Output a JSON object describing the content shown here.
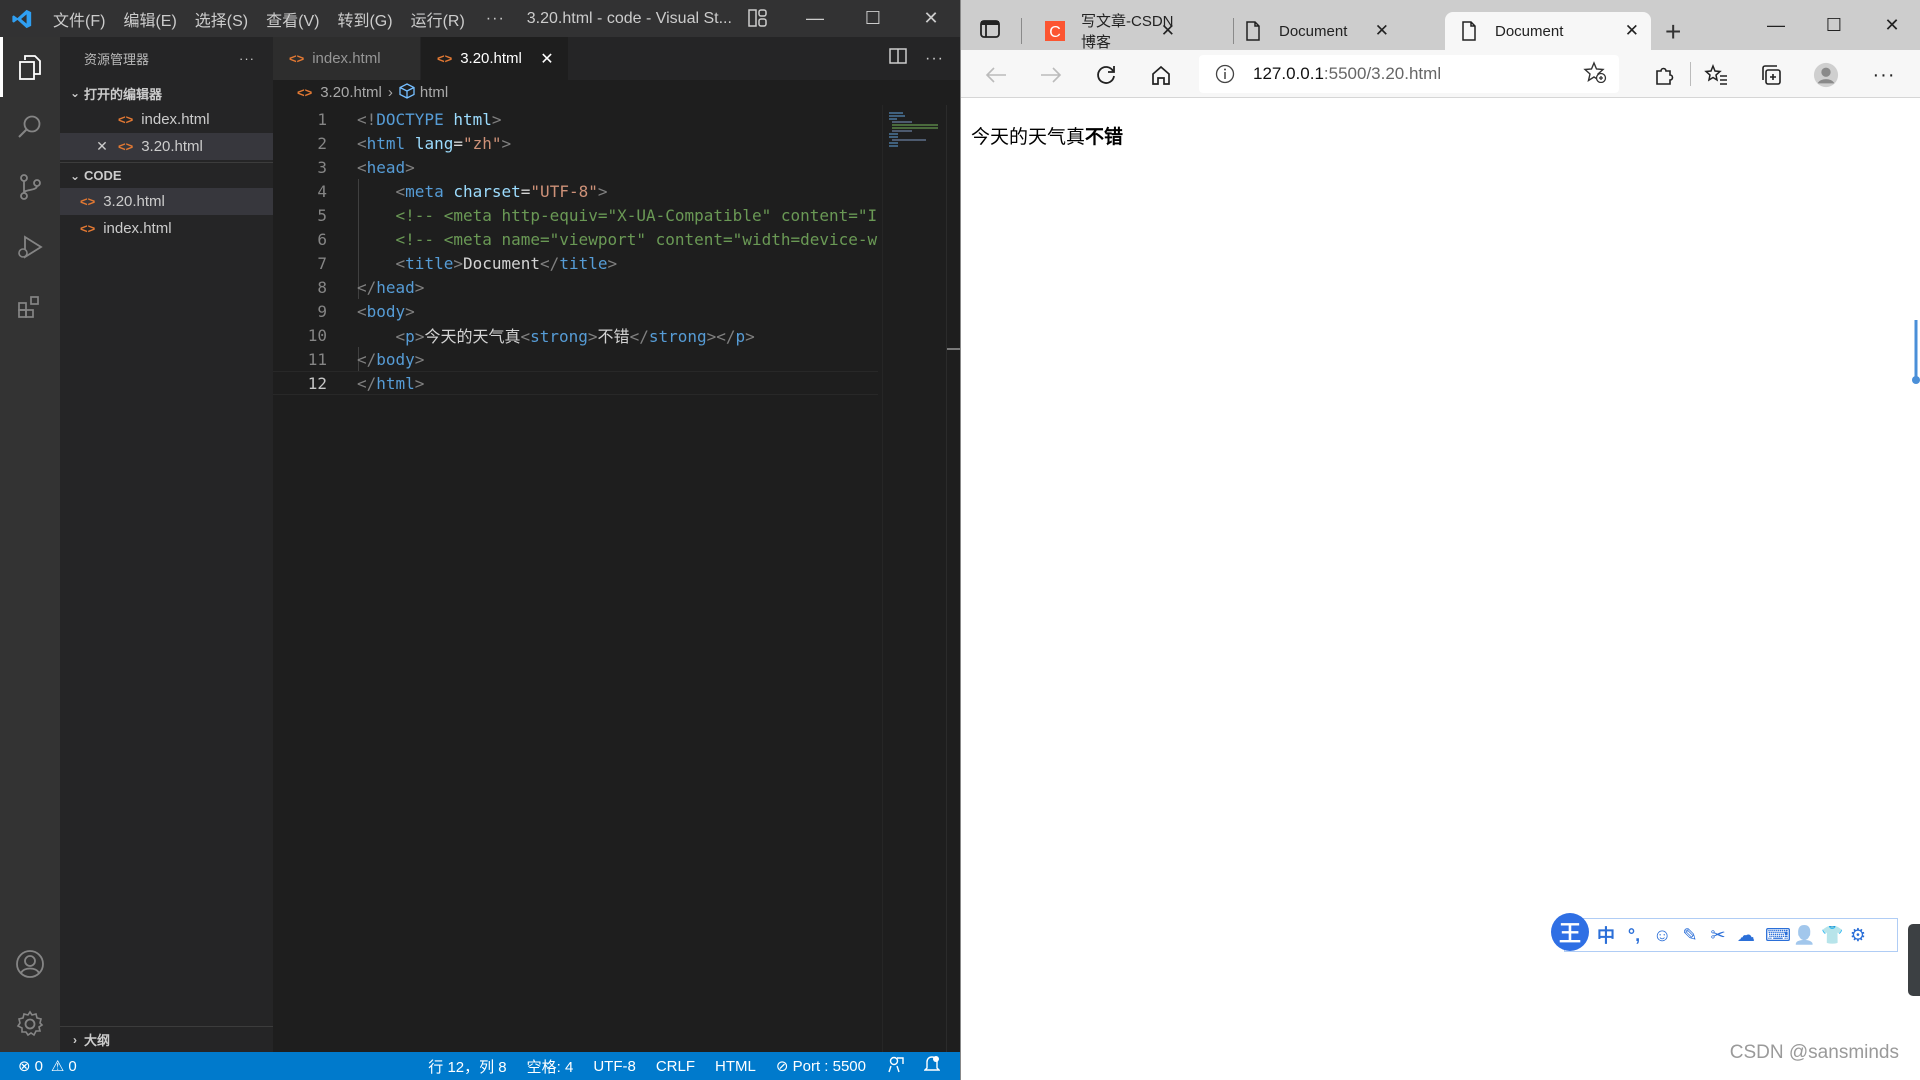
{
  "vscode": {
    "menu": [
      "文件(F)",
      "编辑(E)",
      "选择(S)",
      "查看(V)",
      "转到(G)",
      "运行(R)"
    ],
    "menu_more": "···",
    "window_title": "3.20.html - code - Visual St...",
    "explorer": {
      "header": "资源管理器",
      "header_more": "···",
      "open_editors_label": "打开的编辑器",
      "open_editors": [
        {
          "name": "index.html"
        },
        {
          "name": "3.20.html"
        }
      ],
      "folder_label": "CODE",
      "files": [
        {
          "name": "3.20.html"
        },
        {
          "name": "index.html"
        }
      ],
      "outline_label": "大纲"
    },
    "tabs": [
      {
        "label": "index.html",
        "active": false
      },
      {
        "label": "3.20.html",
        "active": true
      }
    ],
    "breadcrumb": {
      "file": "3.20.html",
      "symbol": "html"
    },
    "code_lines": [
      {
        "n": "1",
        "tokens": [
          [
            "punc",
            "<!"
          ],
          [
            "tag",
            "DOCTYPE"
          ],
          [
            "text",
            " "
          ],
          [
            "attr",
            "html"
          ],
          [
            "punc",
            ">"
          ]
        ]
      },
      {
        "n": "2",
        "tokens": [
          [
            "punc",
            "<"
          ],
          [
            "tag",
            "html"
          ],
          [
            "text",
            " "
          ],
          [
            "attr",
            "lang"
          ],
          [
            "text",
            "="
          ],
          [
            "str",
            "\"zh\""
          ],
          [
            "punc",
            ">"
          ]
        ]
      },
      {
        "n": "3",
        "tokens": [
          [
            "punc",
            "<"
          ],
          [
            "tag",
            "head"
          ],
          [
            "punc",
            ">"
          ]
        ]
      },
      {
        "n": "4",
        "tokens": [
          [
            "text",
            "    "
          ],
          [
            "punc",
            "<"
          ],
          [
            "tag",
            "meta"
          ],
          [
            "text",
            " "
          ],
          [
            "attr",
            "charset"
          ],
          [
            "text",
            "="
          ],
          [
            "str",
            "\"UTF-8\""
          ],
          [
            "punc",
            ">"
          ]
        ]
      },
      {
        "n": "5",
        "tokens": [
          [
            "text",
            "    "
          ],
          [
            "com",
            "<!-- <meta http-equiv=\"X-UA-Compatible\" content=\"I"
          ]
        ]
      },
      {
        "n": "6",
        "tokens": [
          [
            "text",
            "    "
          ],
          [
            "com",
            "<!-- <meta name=\"viewport\" content=\"width=device-w"
          ]
        ]
      },
      {
        "n": "7",
        "tokens": [
          [
            "text",
            "    "
          ],
          [
            "punc",
            "<"
          ],
          [
            "tag",
            "title"
          ],
          [
            "punc",
            ">"
          ],
          [
            "text",
            "Document"
          ],
          [
            "punc",
            "</"
          ],
          [
            "tag",
            "title"
          ],
          [
            "punc",
            ">"
          ]
        ]
      },
      {
        "n": "8",
        "tokens": [
          [
            "punc",
            "</"
          ],
          [
            "tag",
            "head"
          ],
          [
            "punc",
            ">"
          ]
        ]
      },
      {
        "n": "9",
        "tokens": [
          [
            "punc",
            "<"
          ],
          [
            "tag",
            "body"
          ],
          [
            "punc",
            ">"
          ]
        ]
      },
      {
        "n": "10",
        "tokens": [
          [
            "text",
            "    "
          ],
          [
            "punc",
            "<"
          ],
          [
            "tag",
            "p"
          ],
          [
            "punc",
            ">"
          ],
          [
            "text",
            "今天的天气真"
          ],
          [
            "punc",
            "<"
          ],
          [
            "tag",
            "strong"
          ],
          [
            "punc",
            ">"
          ],
          [
            "text",
            "不错"
          ],
          [
            "punc",
            "</"
          ],
          [
            "tag",
            "strong"
          ],
          [
            "punc",
            "></"
          ],
          [
            "tag",
            "p"
          ],
          [
            "punc",
            ">"
          ]
        ]
      },
      {
        "n": "11",
        "tokens": [
          [
            "punc",
            "</"
          ],
          [
            "tag",
            "body"
          ],
          [
            "punc",
            ">"
          ]
        ]
      },
      {
        "n": "12",
        "tokens": [
          [
            "punc",
            "</"
          ],
          [
            "tag",
            "html"
          ],
          [
            "punc",
            ">"
          ]
        ]
      }
    ],
    "current_line": "12",
    "status": {
      "errors": "0",
      "warnings": "0",
      "position": "行 12，列 8",
      "spaces": "空格: 4",
      "encoding": "UTF-8",
      "eol": "CRLF",
      "language": "HTML",
      "port": "Port : 5500"
    }
  },
  "browser": {
    "tabs": [
      {
        "title": "写文章-CSDN博客",
        "favicon": "csdn-icon",
        "active": false
      },
      {
        "title": "Document",
        "favicon": "page-icon",
        "active": false
      },
      {
        "title": "Document",
        "favicon": "page-icon",
        "active": true
      }
    ],
    "new_tab": "+",
    "url_host": "127.0.0.1",
    "url_rest": ":5500/3.20.html",
    "page": {
      "text_normal": "今天的天气真",
      "text_strong": "不错"
    },
    "ime": {
      "logo": "王",
      "icons": [
        "中",
        "°,",
        "☺",
        "✎",
        "✂",
        "☁",
        "⌨",
        "👤",
        "👕",
        "⚙"
      ]
    },
    "watermark": "CSDN @sansminds"
  }
}
